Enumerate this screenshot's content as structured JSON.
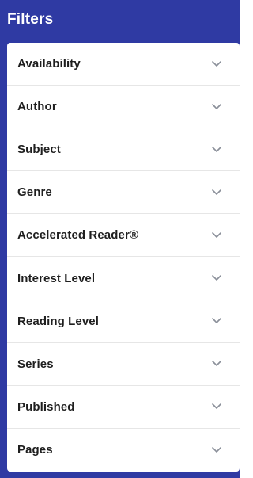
{
  "panel": {
    "title": "Filters",
    "colors": {
      "header_bg": "#2f3aa3",
      "header_text": "#ffffff",
      "list_bg": "#ffffff",
      "divider": "#e6e6e6",
      "label_text": "#1f1f1f",
      "chevron": "#8a8f99"
    },
    "items": [
      {
        "label": "Availability",
        "icon": "chevron-down-icon"
      },
      {
        "label": "Author",
        "icon": "chevron-down-icon"
      },
      {
        "label": "Subject",
        "icon": "chevron-down-icon"
      },
      {
        "label": "Genre",
        "icon": "chevron-down-icon"
      },
      {
        "label": "Accelerated Reader®",
        "icon": "chevron-down-icon"
      },
      {
        "label": "Interest Level",
        "icon": "chevron-down-icon"
      },
      {
        "label": "Reading Level",
        "icon": "chevron-down-icon"
      },
      {
        "label": "Series",
        "icon": "chevron-down-icon"
      },
      {
        "label": "Published",
        "icon": "chevron-down-icon"
      },
      {
        "label": "Pages",
        "icon": "chevron-down-icon"
      }
    ]
  }
}
